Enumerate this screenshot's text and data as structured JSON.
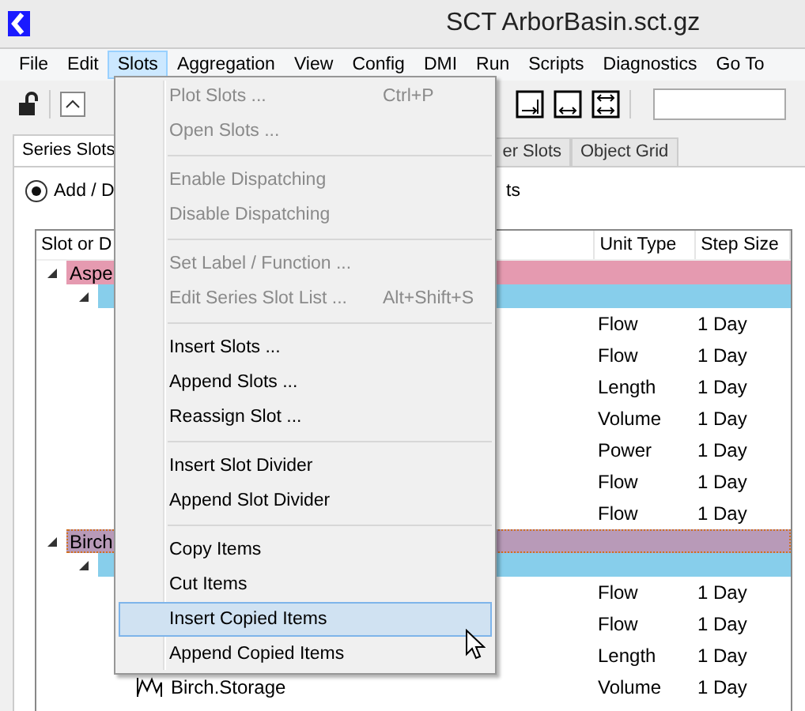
{
  "window": {
    "title": "SCT ArborBasin.sct.gz"
  },
  "menu_bar": [
    {
      "label": "File",
      "selected": false
    },
    {
      "label": "Edit",
      "selected": false
    },
    {
      "label": "Slots",
      "selected": true
    },
    {
      "label": "Aggregation",
      "selected": false
    },
    {
      "label": "View",
      "selected": false
    },
    {
      "label": "Config",
      "selected": false
    },
    {
      "label": "DMI",
      "selected": false
    },
    {
      "label": "Run",
      "selected": false
    },
    {
      "label": "Scripts",
      "selected": false
    },
    {
      "label": "Diagnostics",
      "selected": false
    },
    {
      "label": "Go To",
      "selected": false
    }
  ],
  "tabs": [
    {
      "label": "Series Slots",
      "selected": true
    },
    {
      "label": "er Slots",
      "selected": false
    },
    {
      "label": "Object Grid",
      "selected": false
    }
  ],
  "mode_radio": {
    "label": "Add / D",
    "selected": true
  },
  "mode_text_tail": "ts",
  "table": {
    "columns": [
      "Slot or D",
      "Unit Type",
      "Step Size"
    ],
    "rows": [
      {
        "kind": "divider",
        "label": "Aspe",
        "color": "#e59ab0",
        "expanded": true,
        "focused": false
      },
      {
        "kind": "object",
        "color": "#87ceeb",
        "expanded": true
      },
      {
        "kind": "slot",
        "unit": "Flow",
        "step": "1 Day"
      },
      {
        "kind": "slot",
        "unit": "Flow",
        "step": "1 Day"
      },
      {
        "kind": "slot",
        "unit": "Length",
        "step": "1 Day"
      },
      {
        "kind": "slot",
        "unit": "Volume",
        "step": "1 Day"
      },
      {
        "kind": "slot",
        "unit": "Power",
        "step": "1 Day"
      },
      {
        "kind": "slot",
        "unit": "Flow",
        "step": "1 Day"
      },
      {
        "kind": "slot",
        "unit": "Flow",
        "step": "1 Day"
      },
      {
        "kind": "divider",
        "label": "Birch",
        "color": "#b89ab8",
        "expanded": true,
        "focused": true
      },
      {
        "kind": "object",
        "color": "#87ceeb",
        "expanded": true
      },
      {
        "kind": "slot",
        "unit": "Flow",
        "step": "1 Day"
      },
      {
        "kind": "slot",
        "unit": "Flow",
        "step": "1 Day"
      },
      {
        "kind": "slot",
        "unit": "Length",
        "step": "1 Day"
      },
      {
        "kind": "slot",
        "name": "Birch.Storage",
        "unit": "Volume",
        "step": "1 Day"
      }
    ]
  },
  "slots_menu": [
    {
      "kind": "item",
      "label": "Plot Slots ...",
      "shortcut": "Ctrl+P",
      "disabled": true,
      "selected": false
    },
    {
      "kind": "item",
      "label": "Open Slots ...",
      "disabled": true,
      "selected": false
    },
    {
      "kind": "separator"
    },
    {
      "kind": "item",
      "label": "Enable Dispatching",
      "disabled": true,
      "selected": false
    },
    {
      "kind": "item",
      "label": "Disable Dispatching",
      "disabled": true,
      "selected": false
    },
    {
      "kind": "separator"
    },
    {
      "kind": "item",
      "label": "Set Label / Function ...",
      "disabled": true,
      "selected": false
    },
    {
      "kind": "item",
      "label": "Edit Series Slot List ...",
      "shortcut": "Alt+Shift+S",
      "disabled": true,
      "selected": false
    },
    {
      "kind": "separator"
    },
    {
      "kind": "item",
      "label": "Insert Slots ...",
      "disabled": false,
      "selected": false
    },
    {
      "kind": "item",
      "label": "Append Slots ...",
      "disabled": false,
      "selected": false
    },
    {
      "kind": "item",
      "label": "Reassign Slot ...",
      "disabled": false,
      "selected": false
    },
    {
      "kind": "separator"
    },
    {
      "kind": "item",
      "label": "Insert Slot Divider",
      "disabled": false,
      "selected": false
    },
    {
      "kind": "item",
      "label": "Append Slot Divider",
      "disabled": false,
      "selected": false
    },
    {
      "kind": "separator"
    },
    {
      "kind": "item",
      "label": "Copy Items",
      "disabled": false,
      "selected": false
    },
    {
      "kind": "item",
      "label": "Cut Items",
      "disabled": false,
      "selected": false
    },
    {
      "kind": "item",
      "label": "Insert Copied Items",
      "disabled": false,
      "selected": true
    },
    {
      "kind": "item",
      "label": "Append Copied Items",
      "disabled": false,
      "selected": false
    }
  ]
}
